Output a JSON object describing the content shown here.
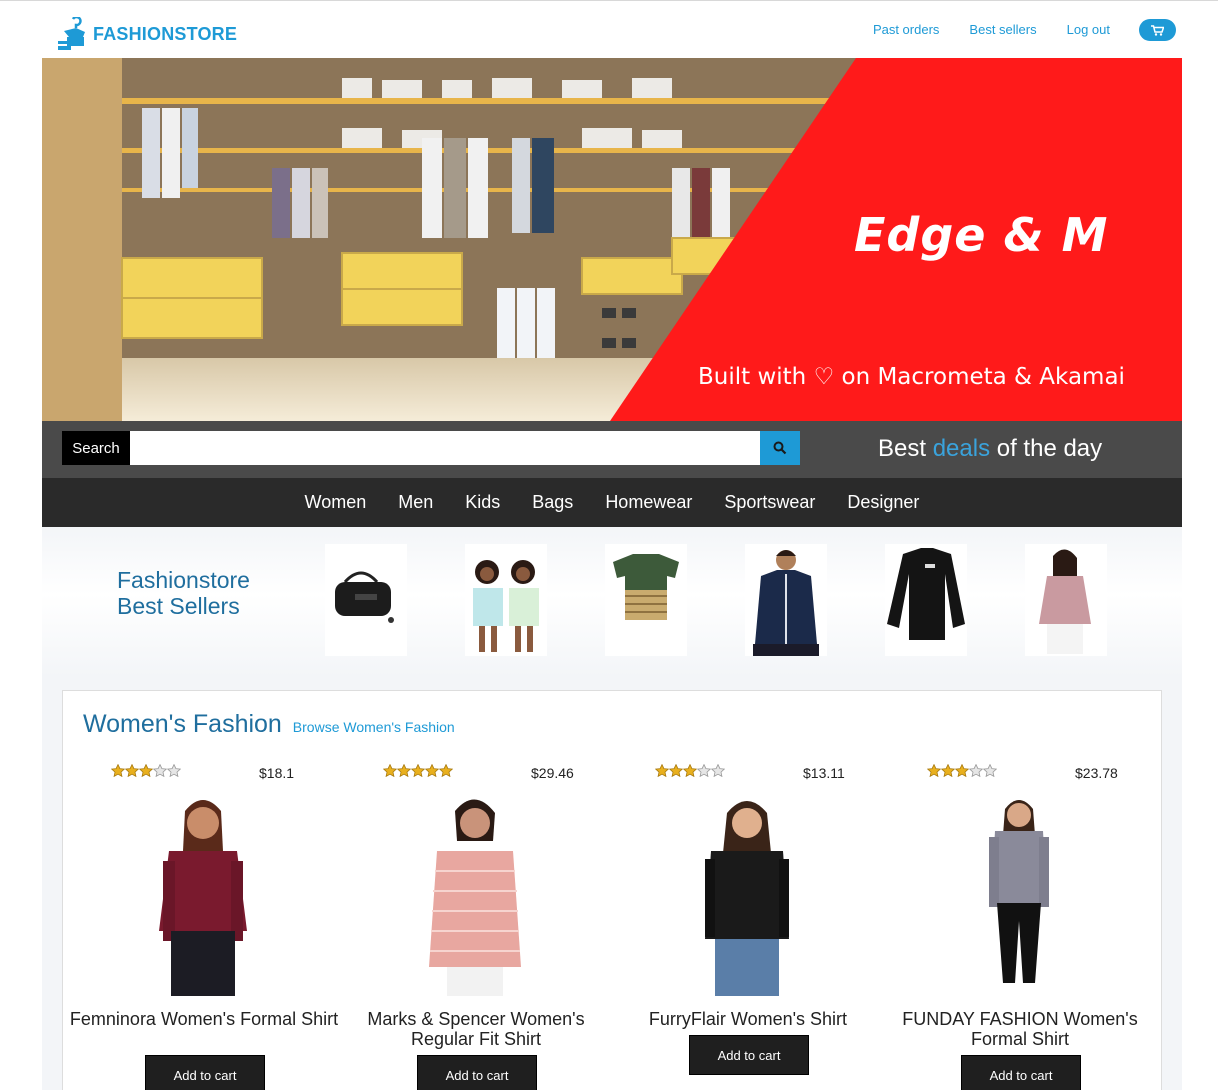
{
  "header": {
    "brand": "FASHIONSTORE",
    "nav": [
      "Past orders",
      "Best sellers",
      "Log out"
    ],
    "accent": "#1e9ad6"
  },
  "hero": {
    "brand": "Edge & M",
    "tagline": "Built with ♡ on Macrometa & Akamai",
    "accent": "#ff1a1a"
  },
  "search": {
    "label": "Search",
    "value": "",
    "deals_prefix": "Best ",
    "deals_highlight": "deals",
    "deals_suffix": " of the day"
  },
  "categories": [
    "Women",
    "Men",
    "Kids",
    "Bags",
    "Homewear",
    "Sportswear",
    "Designer"
  ],
  "best_sellers": {
    "title_line1": "Fashionstore",
    "title_line2": "Best Sellers",
    "items": [
      "duffel-bag",
      "girls-tshirts",
      "striped-tshirt",
      "navy-jacket",
      "black-compression-top",
      "pink-blouse"
    ]
  },
  "womens": {
    "title": "Women's Fashion",
    "link": "Browse Women's Fashion",
    "products": [
      {
        "name": "Femninora Women's Formal Shirt",
        "price": "$18.1",
        "rating": 3,
        "add": "Add to cart",
        "color": "#7a1a2e"
      },
      {
        "name": "Marks & Spencer Women's Regular Fit Shirt",
        "price": "$29.46",
        "rating": 5,
        "add": "Add to cart",
        "color": "#e8a7a0"
      },
      {
        "name": "FurryFlair Women's Shirt",
        "price": "$13.11",
        "rating": 3,
        "add": "Add to cart",
        "color": "#1a1a1a"
      },
      {
        "name": "FUNDAY FASHION Women's Formal Shirt",
        "price": "$23.78",
        "rating": 3,
        "add": "Add to cart",
        "color": "#8a8a9a"
      }
    ]
  }
}
